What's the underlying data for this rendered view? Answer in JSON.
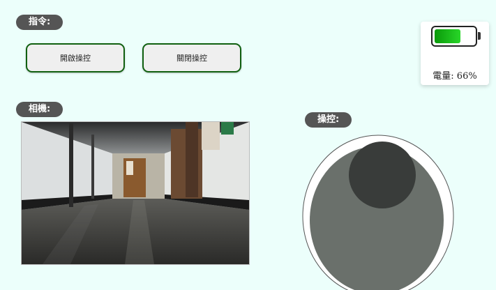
{
  "commands": {
    "label": "指令:",
    "open_button": "開啟操控",
    "close_button": "關閉操控"
  },
  "camera": {
    "label": "相機:"
  },
  "control": {
    "label": "操控:"
  },
  "battery": {
    "text": "電量: 66%",
    "level": 66,
    "fill_color": "#22c622"
  }
}
